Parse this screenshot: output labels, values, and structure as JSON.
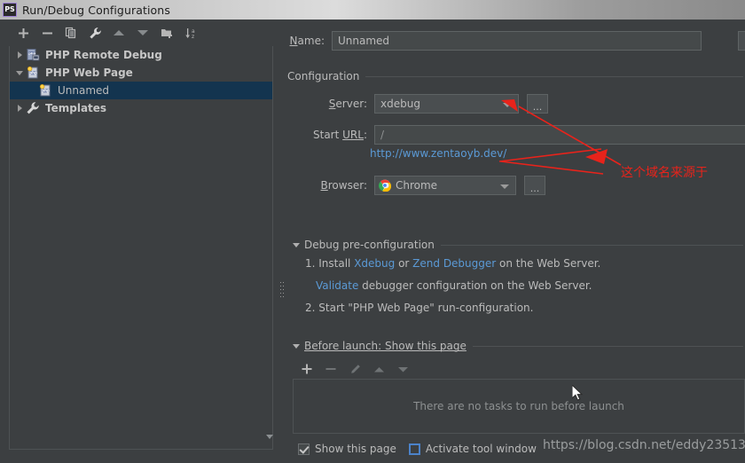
{
  "window": {
    "title": "Run/Debug Configurations",
    "app_icon": "PS"
  },
  "toolbar": {
    "buttons": [
      {
        "name": "add",
        "icon": "plus-icon",
        "label": "+"
      },
      {
        "name": "remove",
        "icon": "minus-icon",
        "label": "−"
      },
      {
        "name": "copy",
        "icon": "copy-icon",
        "label": ""
      },
      {
        "name": "edit-templates",
        "icon": "wrench-icon",
        "label": ""
      },
      {
        "name": "move-up",
        "icon": "arrow-up-icon",
        "label": ""
      },
      {
        "name": "move-down",
        "icon": "arrow-down-icon",
        "label": ""
      },
      {
        "name": "new-folder",
        "icon": "folder-add-icon",
        "label": ""
      },
      {
        "name": "sort-alphabetically",
        "icon": "sort-az-icon",
        "label": ""
      }
    ]
  },
  "tree": {
    "items": [
      {
        "label": "PHP Remote Debug",
        "icon": "php-remote-debug-icon",
        "twisty": "right",
        "depth": 0,
        "selected": false,
        "bold": true
      },
      {
        "label": "PHP Web Page",
        "icon": "php-web-page-icon",
        "twisty": "down",
        "depth": 0,
        "selected": false,
        "bold": true
      },
      {
        "label": "Unnamed",
        "icon": "php-web-page-icon",
        "twisty": "none",
        "depth": 1,
        "selected": true,
        "bold": false
      },
      {
        "label": "Templates",
        "icon": "wrench-icon",
        "twisty": "right",
        "depth": 0,
        "selected": false,
        "bold": true
      }
    ]
  },
  "form": {
    "name_label": "Name:",
    "name_label_mnemonic": "N",
    "name_value": "Unnamed",
    "configuration_group": "Configuration",
    "server_label": "Server:",
    "server_label_mnemonic": "S",
    "server_value": "xdebug",
    "server_browse": "...",
    "start_url_label": "Start URL:",
    "start_url_label_mnemonic": "URL",
    "start_url_value": "/",
    "resolved_url": "http://www.zentaoyb.dev/",
    "browser_label": "Browser:",
    "browser_label_mnemonic": "B",
    "browser_value": "Chrome",
    "browser_icon": "chrome-icon",
    "browser_browse": "..."
  },
  "debug_preconfig": {
    "title": "Debug pre-configuration",
    "step1_prefix": "1. Install ",
    "step1_link1": "Xdebug",
    "step1_mid": " or ",
    "step1_link2": "Zend Debugger",
    "step1_suffix": " on the Web Server.",
    "step1b_link": "Validate",
    "step1b_suffix": " debugger configuration on the Web Server.",
    "step2": "2. Start \"PHP Web Page\" run-configuration."
  },
  "before_launch": {
    "title": "Before launch: Show this page",
    "title_mnemonic": "B",
    "toolbar": [
      {
        "name": "add-task",
        "icon": "plus-icon"
      },
      {
        "name": "remove-task",
        "icon": "minus-icon"
      },
      {
        "name": "edit-task",
        "icon": "pencil-icon"
      },
      {
        "name": "move-task-up",
        "icon": "arrow-up-icon"
      },
      {
        "name": "move-task-down",
        "icon": "arrow-down-icon"
      }
    ],
    "empty_text": "There are no tasks to run before launch",
    "show_page_label": "Show this page",
    "show_page_checked": true,
    "activate_tool_window_label": "Activate tool window",
    "activate_tool_window_checked": false
  },
  "annotations": {
    "note_cn": "这个域名来源于",
    "arrow_color": "#e8231b"
  },
  "watermark": "https://blog.csdn.net/eddy23513",
  "colors": {
    "window_bg": "#3c3f41",
    "field_bg": "#45494a",
    "border": "#5e6364",
    "selection": "#13344f",
    "link": "#5b9ad6",
    "text": "#bbbbbb",
    "accent_red": "#e8231b"
  }
}
